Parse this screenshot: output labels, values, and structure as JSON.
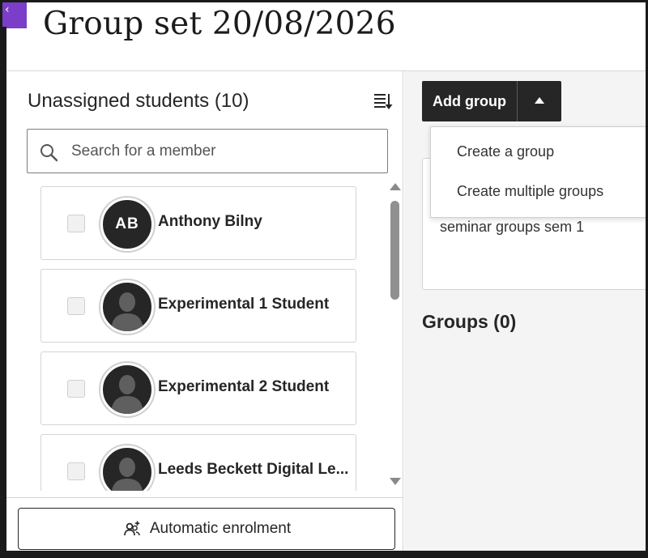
{
  "header": {
    "title": "Group set 20/08/2026"
  },
  "unassigned": {
    "title": "Unassigned students (10)",
    "search_placeholder": "Search for a member",
    "students": [
      {
        "name": "Anthony Bilny",
        "initials": "AB",
        "avatar": "initials"
      },
      {
        "name": "Experimental 1 Student",
        "avatar": "silhouette"
      },
      {
        "name": "Experimental 2 Student",
        "avatar": "silhouette"
      },
      {
        "name": "Leeds Beckett Digital Le...",
        "avatar": "silhouette"
      }
    ],
    "auto_enrol_label": "Automatic enrolment"
  },
  "add_group": {
    "label": "Add group",
    "menu": [
      "Create a group",
      "Create multiple groups"
    ]
  },
  "groupset_text": "seminar groups sem 1",
  "groups_title": "Groups (0)",
  "icons": {
    "sort": "sort-icon",
    "search": "search-icon",
    "checkbox": "checkbox",
    "auto_enrol": "people-add-icon",
    "dropdown_toggle": "caret-up-icon"
  },
  "colors": {
    "accent": "#7b3ec9",
    "dark": "#262626",
    "panel_bg": "#f4f4f4"
  }
}
